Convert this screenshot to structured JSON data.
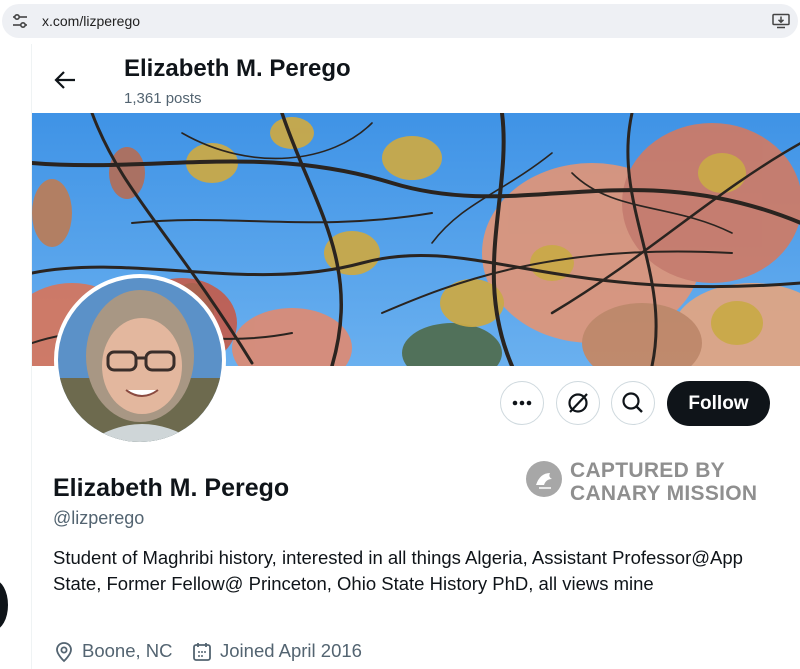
{
  "browser": {
    "url": "x.com/lizperego"
  },
  "header": {
    "name": "Elizabeth M. Perego",
    "posts": "1,361 posts"
  },
  "actions": {
    "follow_label": "Follow"
  },
  "watermark": {
    "line1": "CAPTURED BY",
    "line2": "CANARY MISSION"
  },
  "profile": {
    "name": "Elizabeth M. Perego",
    "handle": "@lizperego",
    "bio": "Student of Maghribi history, interested in all things Algeria, Assistant Professor@App State, Former Fellow@ Princeton, Ohio State History PhD, all views mine",
    "location": "Boone, NC",
    "joined": "Joined April 2016"
  },
  "colors": {
    "follow_bg": "#0f1419",
    "secondary_text": "#536471",
    "sky": "#4a9be6"
  }
}
